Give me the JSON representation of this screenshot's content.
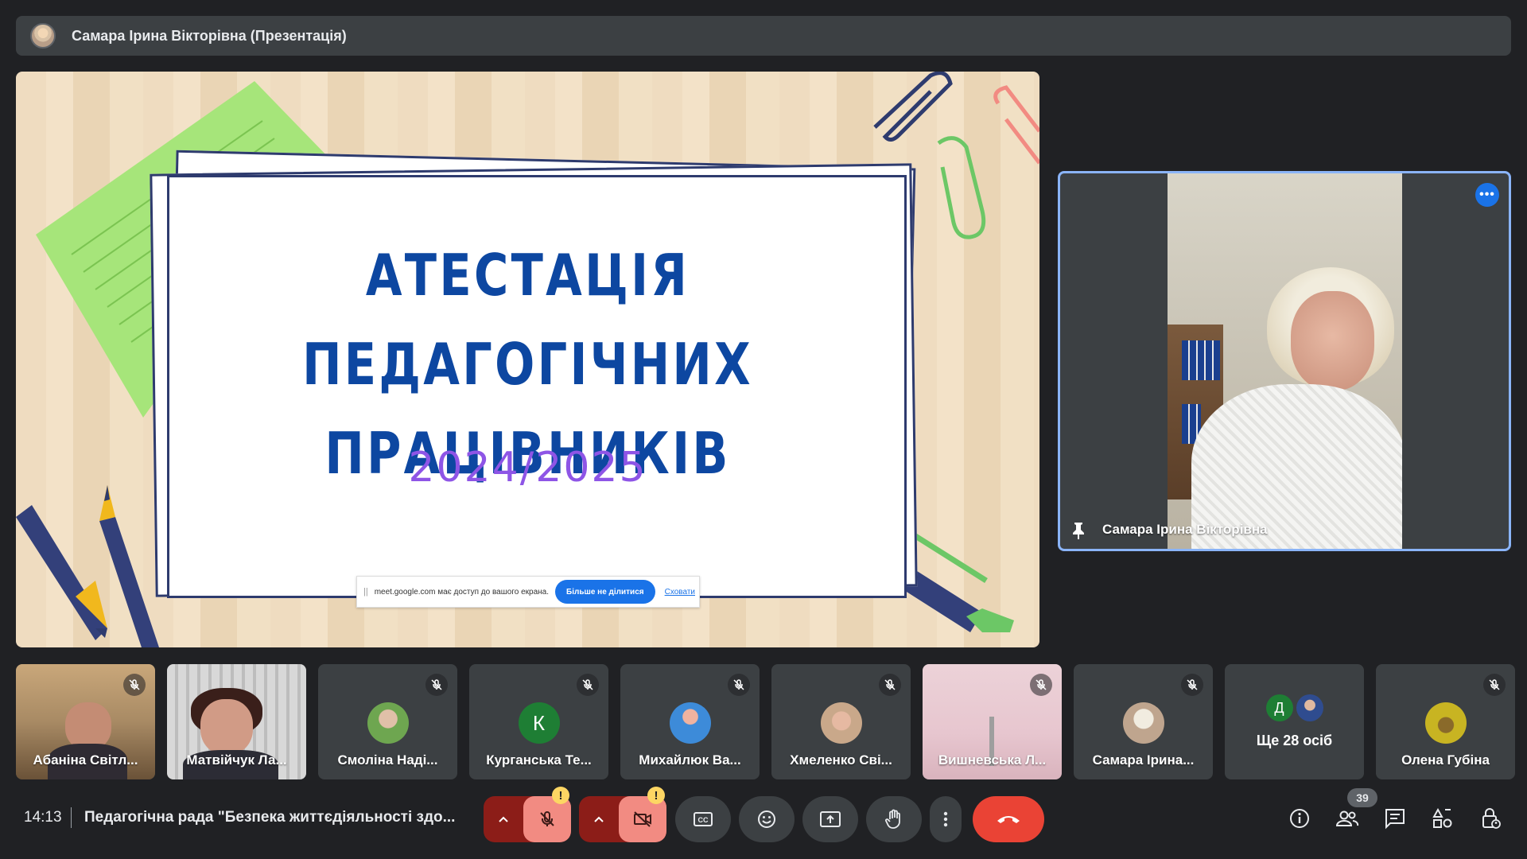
{
  "presenter_bar": {
    "title": "Самара Ірина Вікторівна (Презентація)"
  },
  "slide": {
    "title_line1": "АТЕСТАЦІЯ ПЕДАГОГІЧНИХ",
    "title_line2": "ПРАЦІВНИКІВ",
    "year": "2024/2025",
    "colors": {
      "title": "#0d47a1",
      "year": "#8e55e6"
    }
  },
  "share_notice": {
    "grip": "||",
    "text": "meet.google.com має доступ до вашого екрана.",
    "stop_label": "Більше не ділитися",
    "hide_label": "Сховати"
  },
  "pinned_speaker": {
    "name": "Самара Ірина Вікторівна",
    "more_icon": "more-horiz-icon",
    "pin_icon": "pin-icon"
  },
  "participants": [
    {
      "name": "Абаніна Світл...",
      "type": "video",
      "muted": true
    },
    {
      "name": "Матвійчук Ла...",
      "type": "video",
      "muted": false
    },
    {
      "name": "Смоліна Наді...",
      "type": "photo",
      "muted": true,
      "avatar_color": "#7aa65a"
    },
    {
      "name": "Курганська Те...",
      "type": "letter",
      "letter": "К",
      "muted": true,
      "avatar_color": "#1e7e34"
    },
    {
      "name": "Михайлюк Ва...",
      "type": "photo",
      "muted": true,
      "avatar_color": "#3d8bd9"
    },
    {
      "name": "Хмеленко Сві...",
      "type": "photo",
      "muted": true,
      "avatar_color": "#c9a88a"
    },
    {
      "name": "Вишневська Л...",
      "type": "video",
      "muted": true
    },
    {
      "name": "Самара Ірина...",
      "type": "photo",
      "muted": true,
      "avatar_color": "#bfa58e"
    },
    {
      "name": "Олена Губіна",
      "type": "photo",
      "muted": true,
      "avatar_color": "#c8b422"
    }
  ],
  "more_participants": {
    "label": "Ще 28 осіб",
    "letter": "Д",
    "letter_color": "#1e7e34"
  },
  "bottom_bar": {
    "time": "14:13",
    "meeting_title": "Педагогічна рада \"Безпека життєдіяльності здо...",
    "warning_symbol": "!",
    "people_count": "39"
  }
}
